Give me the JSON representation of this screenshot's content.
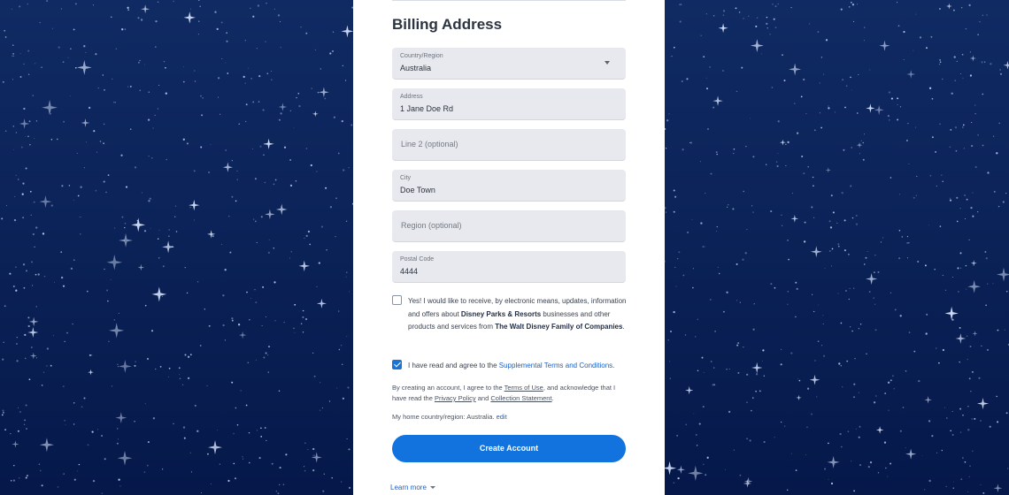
{
  "billing": {
    "title": "Billing Address",
    "country": {
      "label": "Country/Region",
      "value": "Australia"
    },
    "address": {
      "label": "Address",
      "value": "1 Jane Doe Rd"
    },
    "line2": {
      "placeholder": "Line 2 (optional)"
    },
    "city": {
      "label": "City",
      "value": "Doe Town"
    },
    "region": {
      "placeholder": "Region (optional)"
    },
    "postal": {
      "label": "Postal Code",
      "value": "4444"
    }
  },
  "marketing": {
    "checked": false,
    "text_1": "Yes! I would like to receive, by electronic means, updates, information and offers about",
    "brand_1": "Disney Parks & Resorts",
    "text_2": "businesses and other products and services from",
    "brand_2": "The Walt Disney Family of Companies",
    "text_3": "."
  },
  "terms": {
    "checked": true,
    "text": "I have read and agree to the",
    "link": "Supplemental Terms and Conditions",
    "suffix": "."
  },
  "legal": {
    "part_1": "By creating an account, I agree to the",
    "terms_of_use": "Terms of Use",
    "part_2": ", and acknowledge that I have read the",
    "privacy_policy": "Privacy Policy",
    "part_3": "and",
    "collection_statement": "Collection Statement",
    "part_4": "."
  },
  "home_country": {
    "text": "My home country/region: Australia.",
    "edit": "edit"
  },
  "create_button": "Create Account",
  "learn_more": "Learn more",
  "colors": {
    "accent": "#1273de",
    "background": "#0b2358",
    "field_bg": "#e8e9ee"
  }
}
